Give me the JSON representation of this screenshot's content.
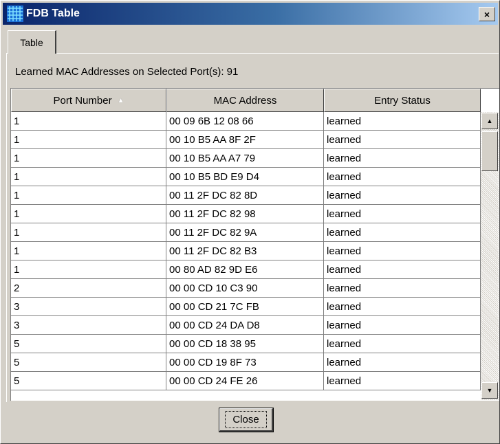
{
  "window": {
    "title": "FDB Table",
    "close_glyph": "×",
    "icon": "grid-app-icon"
  },
  "tabs": [
    {
      "label": "Table"
    }
  ],
  "summary": "Learned MAC Addresses on Selected Port(s): 91",
  "table": {
    "columns": [
      {
        "label": "Port Number",
        "sort_indicator": "▲"
      },
      {
        "label": "MAC Address"
      },
      {
        "label": "Entry Status"
      }
    ],
    "rows": [
      {
        "port": "1",
        "mac": "00 09 6B 12 08 66",
        "status": "learned"
      },
      {
        "port": "1",
        "mac": "00 10 B5 AA 8F 2F",
        "status": "learned"
      },
      {
        "port": "1",
        "mac": "00 10 B5 AA A7 79",
        "status": "learned"
      },
      {
        "port": "1",
        "mac": "00 10 B5 BD E9 D4",
        "status": "learned"
      },
      {
        "port": "1",
        "mac": "00 11 2F DC 82 8D",
        "status": "learned"
      },
      {
        "port": "1",
        "mac": "00 11 2F DC 82 98",
        "status": "learned"
      },
      {
        "port": "1",
        "mac": "00 11 2F DC 82 9A",
        "status": "learned"
      },
      {
        "port": "1",
        "mac": "00 11 2F DC 82 B3",
        "status": "learned"
      },
      {
        "port": "1",
        "mac": "00 80 AD 82 9D E6",
        "status": "learned"
      },
      {
        "port": "2",
        "mac": "00 00 CD 10 C3 90",
        "status": "learned"
      },
      {
        "port": "3",
        "mac": "00 00 CD 21 7C FB",
        "status": "learned"
      },
      {
        "port": "3",
        "mac": "00 00 CD 24 DA D8",
        "status": "learned"
      },
      {
        "port": "5",
        "mac": "00 00 CD 18 38 95",
        "status": "learned"
      },
      {
        "port": "5",
        "mac": "00 00 CD 19 8F 73",
        "status": "learned"
      },
      {
        "port": "5",
        "mac": "00 00 CD 24 FE 26",
        "status": "learned"
      }
    ]
  },
  "scrollbar": {
    "up_glyph": "▲",
    "down_glyph": "▼"
  },
  "buttons": {
    "close_label": "Close"
  },
  "colors": {
    "title_start": "#0a246a",
    "title_end": "#a6caf0",
    "face": "#d4d0c8"
  }
}
